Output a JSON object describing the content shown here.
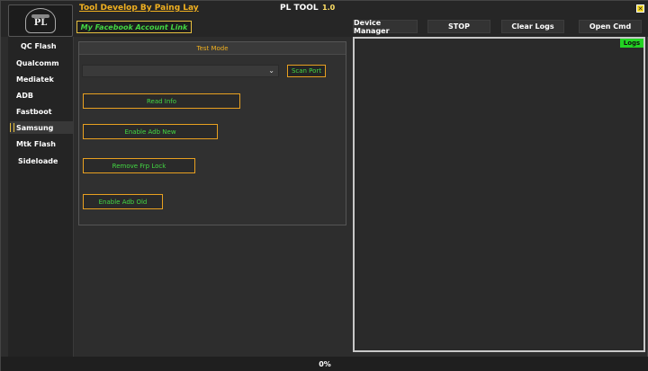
{
  "app": {
    "title": "PL TOOL",
    "version": "1.0",
    "developer_link": "Tool Develop By Paing Lay",
    "facebook_link": "My Facebook Account Link",
    "logo_text": "PL",
    "close_icon": "close-icon"
  },
  "toolbar": {
    "device_manager": "Device Manager",
    "stop": "STOP",
    "clear_logs": "Clear Logs",
    "open_cmd": "Open Cmd"
  },
  "sidebar": {
    "items": [
      {
        "label": "QC Flash",
        "active": false
      },
      {
        "label": "Qualcomm",
        "active": false
      },
      {
        "label": "Mediatek",
        "active": false
      },
      {
        "label": "ADB",
        "active": false
      },
      {
        "label": "Fastboot",
        "active": false
      },
      {
        "label": "Samsung",
        "active": true
      },
      {
        "label": "Mtk Flash",
        "active": false
      },
      {
        "label": "Sideloade",
        "active": false
      }
    ]
  },
  "main": {
    "mode_title": "Test Mode",
    "port_select_value": "",
    "scan_port": "Scan Port",
    "actions": [
      {
        "label": "Read Info"
      },
      {
        "label": "Enable Adb New"
      },
      {
        "label": "Remove Frp Lock"
      },
      {
        "label": "Enable Adb Old"
      }
    ]
  },
  "logs": {
    "label": "Logs",
    "content": ""
  },
  "status": {
    "progress_text": "0%",
    "progress_value": 0
  },
  "colors": {
    "accent_orange": "#e8a020",
    "accent_green": "#43d843",
    "logs_green": "#22d422",
    "close_yellow": "#f5d623"
  }
}
